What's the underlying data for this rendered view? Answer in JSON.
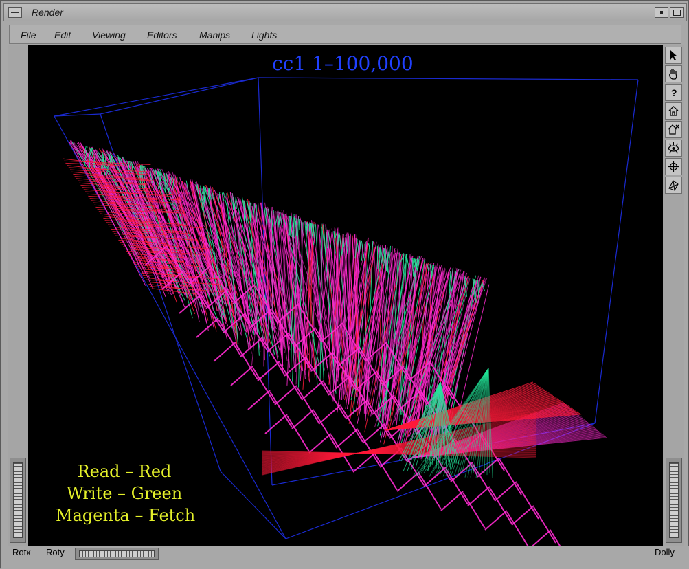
{
  "window": {
    "title": "Render"
  },
  "menubar": {
    "items": [
      "File",
      "Edit",
      "Viewing",
      "Editors",
      "Manips",
      "Lights"
    ]
  },
  "viewer": {
    "scene_title": "cc1  1–100,000",
    "legend": [
      "Read – Red",
      "Write – Green",
      "Magenta – Fetch"
    ],
    "colors": {
      "read": "#ff1a3a",
      "write": "#22e89a",
      "fetch": "#ff2ad0",
      "box": "#1a2ad0",
      "title": "#2040ff",
      "legend": "#e4f02a"
    }
  },
  "toolbar": {
    "icons": [
      "pointer-icon",
      "hand-icon",
      "help-icon",
      "home-icon",
      "set-home-icon",
      "view-all-icon",
      "seek-icon",
      "projection-icon"
    ]
  },
  "bottom": {
    "rotx": "Rotx",
    "roty": "Roty",
    "dolly": "Dolly"
  }
}
